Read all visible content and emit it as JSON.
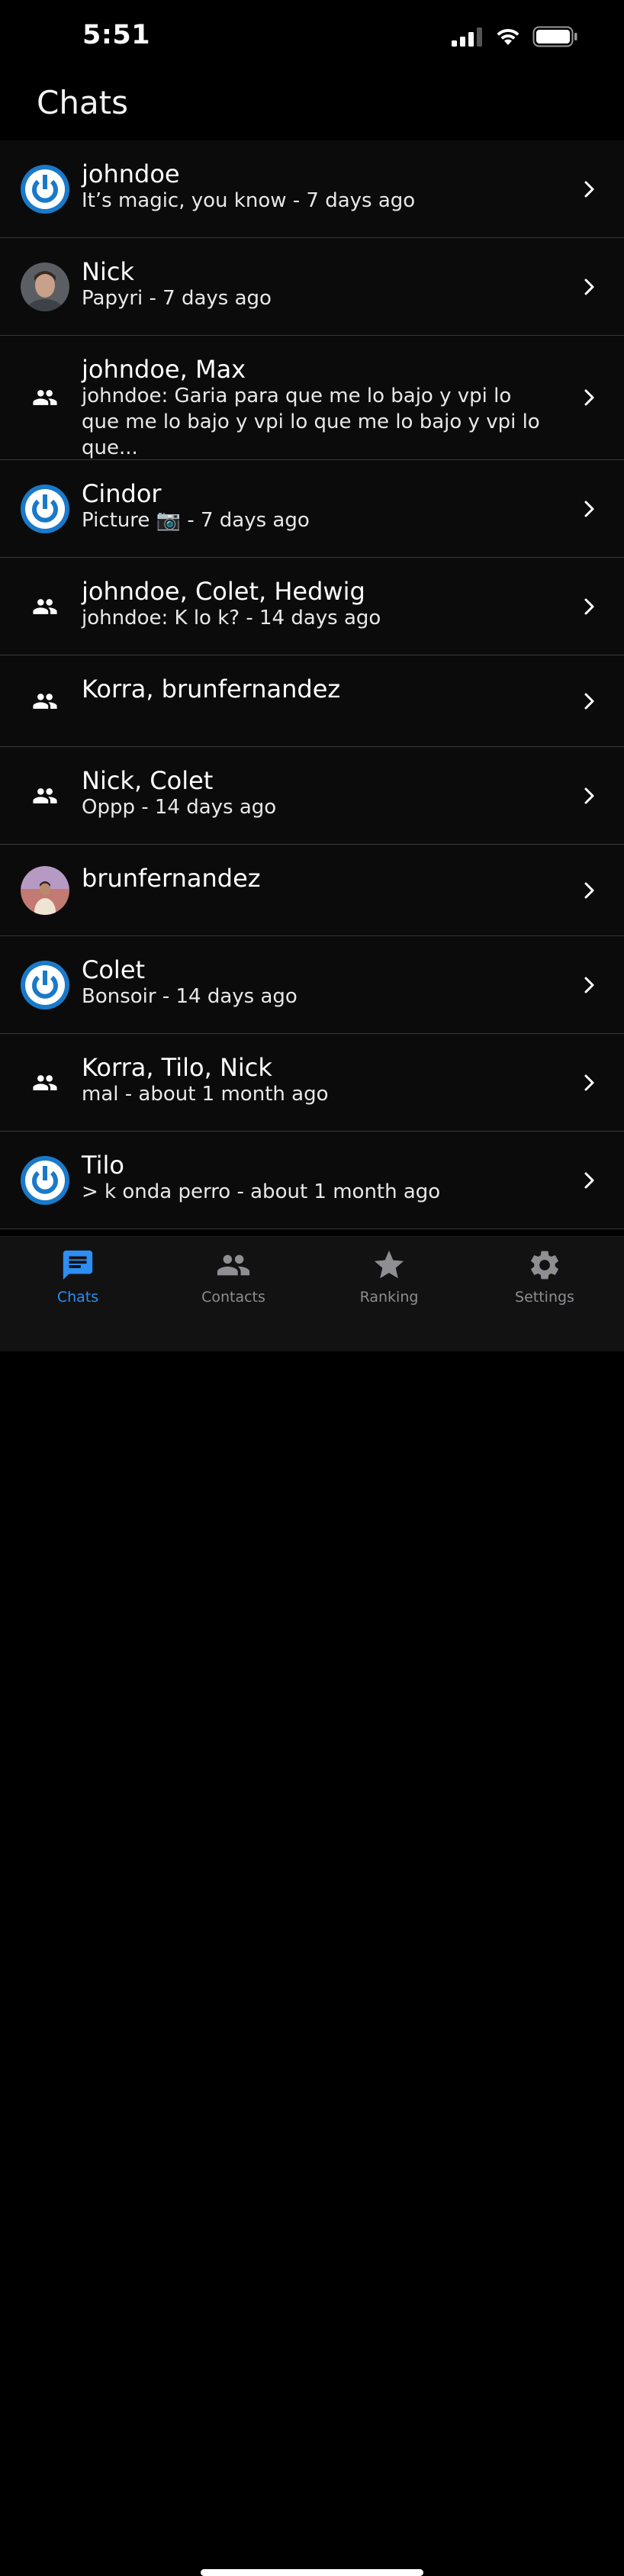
{
  "status_bar": {
    "time": "5:51"
  },
  "header": {
    "title": "Chats"
  },
  "chats": [
    {
      "name": "johndoe",
      "message": "It’s magic, you know - 7 days ago",
      "avatar": "power-logo"
    },
    {
      "name": "Nick",
      "message": "Papyri - 7 days ago",
      "avatar": "photo-nick"
    },
    {
      "name": "johndoe, Max",
      "message": "johndoe: Garia para que me lo bajo y vpi lo que me lo bajo y vpi lo que me lo bajo y vpi lo que...",
      "avatar": "group"
    },
    {
      "name": "Cindor",
      "message": "Picture 📷 - 7 days ago",
      "avatar": "power-logo"
    },
    {
      "name": "johndoe, Colet, Hedwig",
      "message": "johndoe: K lo k? - 14 days ago",
      "avatar": "group"
    },
    {
      "name": "Korra, brunfernandez",
      "message": "",
      "avatar": "group"
    },
    {
      "name": "Nick, Colet",
      "message": "Oppp - 14 days ago",
      "avatar": "group"
    },
    {
      "name": "brunfernandez",
      "message": "",
      "avatar": "photo-brun"
    },
    {
      "name": "Colet",
      "message": "Bonsoir - 14 days ago",
      "avatar": "power-logo"
    },
    {
      "name": "Korra, Tilo, Nick",
      "message": "mal - about 1 month ago",
      "avatar": "group"
    },
    {
      "name": "Tilo",
      "message": "> k onda perro - about 1 month ago",
      "avatar": "power-logo"
    }
  ],
  "tabs": [
    {
      "label": "Chats",
      "icon": "chat-icon",
      "active": true
    },
    {
      "label": "Contacts",
      "icon": "contacts-icon",
      "active": false
    },
    {
      "label": "Ranking",
      "icon": "star-icon",
      "active": false
    },
    {
      "label": "Settings",
      "icon": "gear-icon",
      "active": false
    }
  ],
  "colors": {
    "accent": "#2d8ef3",
    "power_logo": "#1a79c9",
    "background": "#000000",
    "row": "#0b0b0b"
  }
}
